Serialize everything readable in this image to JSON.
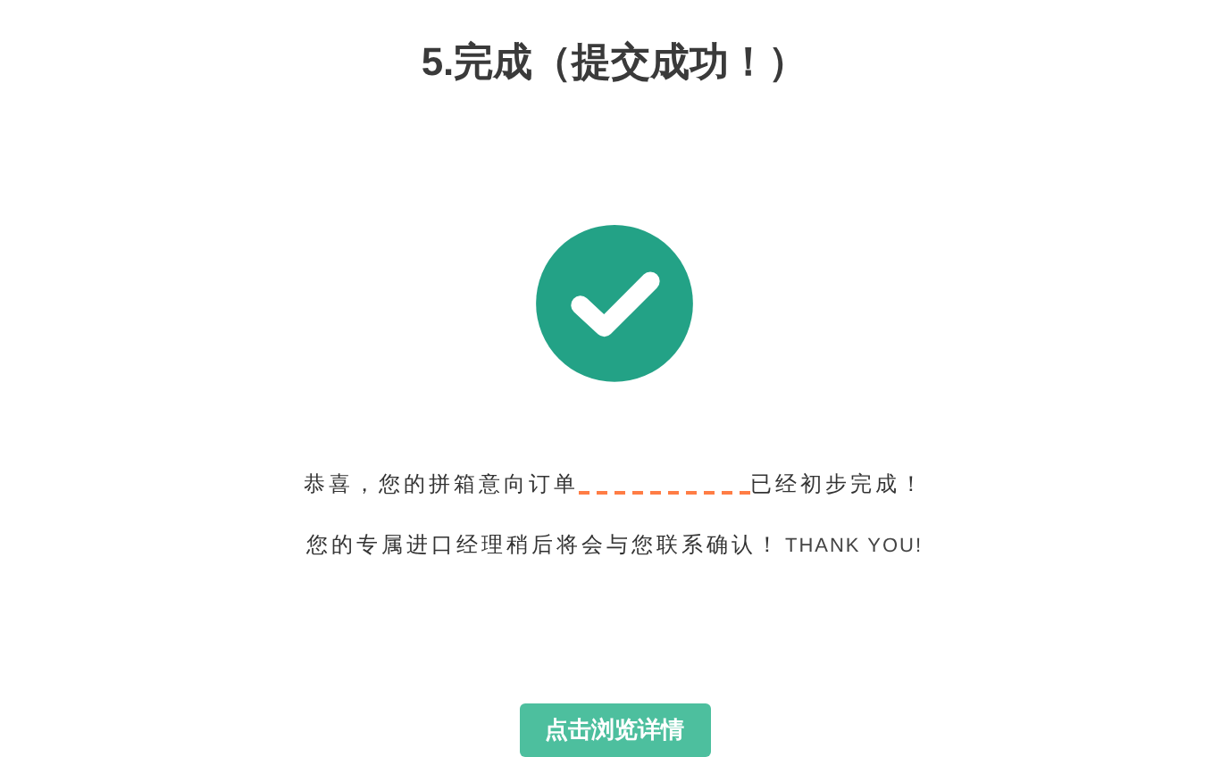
{
  "title": "5.完成（提交成功！）",
  "message": {
    "line_1_before": "恭喜，您的拼箱意向订单",
    "line_1_after": "已经初步完成！",
    "line_2": "您的专属进口经理稍后将会与您联系确认！",
    "line_2_english": "THANK YOU!"
  },
  "button": "点击浏览详情"
}
